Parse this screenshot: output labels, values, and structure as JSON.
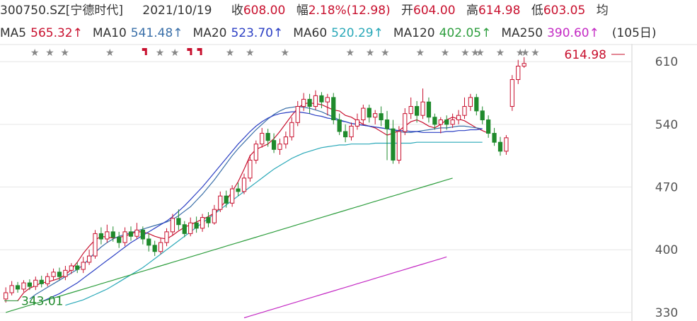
{
  "header": {
    "code": "300750.SZ",
    "name": "[宁德时代]",
    "date": "2021/10/19",
    "close_label": "收",
    "close_value": "608.00",
    "change_label": "幅",
    "change_value": "2.18%(12.98)",
    "open_label": "开",
    "open_value": "604.00",
    "high_label": "高",
    "high_value": "614.98",
    "low_label": "低",
    "low_value": "603.05",
    "avg_label": "均"
  },
  "ma_bar": [
    {
      "label": "MA5",
      "value": "565.32↑",
      "color": "#c8102e"
    },
    {
      "label": "MA10",
      "value": "541.48↑",
      "color": "#3a6fa8"
    },
    {
      "label": "MA20",
      "value": "523.70↑",
      "color": "#2b3fc4"
    },
    {
      "label": "MA60",
      "value": "520.29↑",
      "color": "#29a8b8"
    },
    {
      "label": "MA120",
      "value": "402.05↑",
      "color": "#2e9e3e"
    },
    {
      "label": "MA250",
      "value": "390.60↑",
      "color": "#c42ac4"
    },
    {
      "label": "",
      "value": "(105日)",
      "color": "#333333"
    }
  ],
  "colors": {
    "up": "#c8102e",
    "down": "#1f8a2c",
    "grid": "#e6e6e6",
    "text": "#333333"
  },
  "chart_data": {
    "type": "candlestick",
    "y_ticks": [
      "610",
      "540",
      "470",
      "400",
      "330"
    ],
    "ylim": [
      322,
      622
    ],
    "x_count": 105,
    "candles": [
      [
        345,
        352,
        341,
        358
      ],
      [
        352,
        360,
        349,
        365
      ],
      [
        360,
        356,
        352,
        364
      ],
      [
        356,
        363,
        353,
        366
      ],
      [
        363,
        359,
        355,
        367
      ],
      [
        359,
        366,
        355,
        370
      ],
      [
        366,
        362,
        358,
        371
      ],
      [
        362,
        370,
        359,
        374
      ],
      [
        370,
        375,
        366,
        379
      ],
      [
        375,
        370,
        366,
        380
      ],
      [
        370,
        377,
        366,
        382
      ],
      [
        377,
        382,
        373,
        385
      ],
      [
        382,
        378,
        374,
        386
      ],
      [
        378,
        386,
        374,
        392
      ],
      [
        386,
        393,
        383,
        400
      ],
      [
        393,
        418,
        390,
        422
      ],
      [
        418,
        412,
        406,
        425
      ],
      [
        412,
        420,
        408,
        428
      ],
      [
        420,
        414,
        409,
        426
      ],
      [
        414,
        408,
        402,
        420
      ],
      [
        408,
        420,
        404,
        425
      ],
      [
        420,
        415,
        410,
        426
      ],
      [
        415,
        422,
        412,
        430
      ],
      [
        422,
        412,
        406,
        426
      ],
      [
        412,
        405,
        398,
        418
      ],
      [
        405,
        398,
        393,
        410
      ],
      [
        398,
        408,
        395,
        413
      ],
      [
        408,
        420,
        404,
        424
      ],
      [
        420,
        435,
        416,
        440
      ],
      [
        435,
        428,
        422,
        445
      ],
      [
        428,
        418,
        414,
        432
      ],
      [
        418,
        430,
        415,
        436
      ],
      [
        430,
        424,
        419,
        437
      ],
      [
        424,
        436,
        420,
        440
      ],
      [
        436,
        430,
        425,
        442
      ],
      [
        430,
        445,
        428,
        450
      ],
      [
        445,
        460,
        442,
        465
      ],
      [
        460,
        452,
        447,
        466
      ],
      [
        452,
        468,
        448,
        472
      ],
      [
        468,
        465,
        460,
        475
      ],
      [
        465,
        480,
        462,
        485
      ],
      [
        480,
        500,
        476,
        506
      ],
      [
        500,
        518,
        496,
        522
      ],
      [
        518,
        530,
        514,
        536
      ],
      [
        530,
        522,
        515,
        535
      ],
      [
        522,
        512,
        508,
        530
      ],
      [
        512,
        518,
        506,
        524
      ],
      [
        518,
        526,
        513,
        532
      ],
      [
        526,
        542,
        522,
        548
      ],
      [
        542,
        560,
        538,
        566
      ],
      [
        560,
        568,
        555,
        575
      ],
      [
        568,
        560,
        552,
        574
      ],
      [
        560,
        572,
        556,
        578
      ],
      [
        572,
        565,
        558,
        576
      ],
      [
        565,
        570,
        550,
        574
      ],
      [
        570,
        545,
        540,
        575
      ],
      [
        545,
        532,
        528,
        552
      ],
      [
        532,
        526,
        520,
        540
      ],
      [
        526,
        538,
        522,
        542
      ],
      [
        538,
        545,
        534,
        552
      ],
      [
        545,
        558,
        540,
        562
      ],
      [
        558,
        548,
        542,
        562
      ],
      [
        548,
        552,
        540,
        556
      ],
      [
        552,
        545,
        538,
        560
      ],
      [
        545,
        535,
        500,
        555
      ],
      [
        535,
        500,
        496,
        545
      ],
      [
        500,
        532,
        496,
        538
      ],
      [
        532,
        552,
        528,
        558
      ],
      [
        552,
        560,
        546,
        570
      ],
      [
        560,
        550,
        542,
        566
      ],
      [
        550,
        565,
        546,
        580
      ],
      [
        565,
        548,
        542,
        570
      ],
      [
        548,
        540,
        534,
        552
      ],
      [
        540,
        545,
        530,
        548
      ],
      [
        545,
        540,
        534,
        550
      ],
      [
        540,
        545,
        536,
        552
      ],
      [
        545,
        550,
        540,
        556
      ],
      [
        550,
        560,
        546,
        570
      ],
      [
        560,
        570,
        555,
        574
      ],
      [
        570,
        555,
        550,
        574
      ],
      [
        555,
        545,
        540,
        560
      ],
      [
        545,
        530,
        525,
        550
      ],
      [
        530,
        520,
        516,
        536
      ],
      [
        520,
        510,
        505,
        526
      ],
      [
        510,
        525,
        506,
        528
      ]
    ],
    "ma_lines": [
      {
        "name": "MA5",
        "color": "#c8102e",
        "start": 2,
        "points": [
          343,
          352,
          357,
          360,
          363,
          364,
          366,
          368,
          372,
          378,
          386,
          396,
          404,
          411,
          415,
          414,
          413,
          414,
          415,
          418,
          420,
          420,
          418,
          415,
          413,
          412,
          416,
          421,
          425,
          428,
          431,
          434,
          437,
          441,
          447,
          455,
          465,
          476,
          490,
          505,
          512,
          515,
          518,
          524,
          532,
          541,
          550,
          558,
          563,
          564,
          563,
          562,
          559,
          556,
          555,
          550,
          548,
          544,
          540,
          538,
          536,
          532,
          528,
          530,
          533,
          538,
          543,
          545,
          542,
          538,
          536,
          540,
          545,
          548,
          546,
          544,
          540,
          536,
          533,
          530
        ]
      },
      {
        "name": "MA10",
        "color": "#3a6fa8",
        "start": 4,
        "points": [
          345,
          350,
          354,
          358,
          362,
          366,
          370,
          374,
          378,
          383,
          390,
          397,
          403,
          408,
          412,
          415,
          417,
          419,
          421,
          423,
          425,
          427,
          429,
          431,
          434,
          438,
          443,
          448,
          455,
          462,
          470,
          478,
          487,
          496,
          505,
          513,
          520,
          527,
          534,
          540,
          546,
          551,
          555,
          558,
          559,
          560,
          559,
          558,
          556,
          554,
          551,
          548,
          545,
          543,
          541,
          540,
          539,
          538,
          537,
          536,
          535,
          534,
          532,
          531,
          531,
          532,
          533,
          534,
          535,
          536,
          536,
          537,
          538,
          538,
          537,
          536,
          535
        ]
      },
      {
        "name": "MA20",
        "color": "#2b3fc4",
        "start": 6,
        "points": [
          342,
          345,
          348,
          351,
          355,
          359,
          363,
          368,
          373,
          378,
          383,
          388,
          393,
          398,
          403,
          408,
          412,
          416,
          420,
          424,
          428,
          432,
          437,
          443,
          449,
          456,
          463,
          470,
          478,
          486,
          494,
          502,
          510,
          518,
          525,
          532,
          538,
          543,
          547,
          550,
          552,
          553,
          554,
          554,
          553,
          552,
          550,
          549,
          547,
          546,
          544,
          543,
          541,
          540,
          539,
          538,
          537,
          536,
          535,
          534,
          533,
          533,
          532,
          532,
          531,
          531,
          531,
          531,
          532,
          532,
          533,
          533,
          534,
          534,
          535
        ]
      },
      {
        "name": "MA60",
        "color": "#29a8b8",
        "start": 10,
        "points": [
          338,
          340,
          342,
          344,
          347,
          350,
          353,
          356,
          360,
          364,
          368,
          372,
          376,
          380,
          385,
          390,
          395,
          400,
          405,
          410,
          415,
          420,
          425,
          430,
          435,
          440,
          445,
          450,
          455,
          460,
          465,
          470,
          475,
          480,
          485,
          490,
          494,
          498,
          502,
          505,
          508,
          510,
          512,
          514,
          515,
          516,
          517,
          517,
          518,
          518,
          518,
          518,
          519,
          519,
          519,
          519,
          519,
          519,
          519,
          520,
          520,
          520,
          520,
          520,
          520,
          520,
          520,
          520,
          520,
          520,
          520
        ]
      },
      {
        "name": "MA120",
        "color": "#2e9e3e",
        "start": 0,
        "points": [
          330,
          332,
          334,
          336,
          338,
          340,
          342,
          344,
          346,
          348,
          350,
          352,
          354,
          356,
          358,
          360,
          362,
          364,
          366,
          368,
          370,
          372,
          374,
          376,
          378,
          380,
          382,
          384,
          386,
          388,
          390,
          392,
          394,
          396,
          398,
          400,
          402,
          404,
          406,
          408,
          410,
          412,
          414,
          416,
          418,
          420,
          422,
          424,
          426,
          428,
          430,
          432,
          434,
          436,
          438,
          440,
          442,
          444,
          446,
          448,
          450,
          452,
          454,
          456,
          458,
          460,
          462,
          464,
          466,
          468,
          470,
          472,
          474,
          476,
          478,
          480
        ]
      },
      {
        "name": "MA250",
        "color": "#c42ac4",
        "start": 40,
        "points": [
          324,
          326,
          328,
          330,
          332,
          334,
          336,
          338,
          340,
          342,
          344,
          346,
          348,
          350,
          352,
          354,
          356,
          358,
          360,
          362,
          364,
          366,
          368,
          370,
          372,
          374,
          376,
          378,
          380,
          382,
          384,
          386,
          388,
          390,
          392
        ]
      }
    ],
    "stars": [
      4,
      7,
      10,
      19,
      29,
      32,
      43,
      47,
      54,
      67,
      71,
      74,
      81,
      86,
      90,
      92,
      93,
      97,
      101,
      102,
      104
    ],
    "flags": [
      26,
      35,
      37
    ],
    "max_label": "614.98",
    "min_label": "343.01"
  }
}
